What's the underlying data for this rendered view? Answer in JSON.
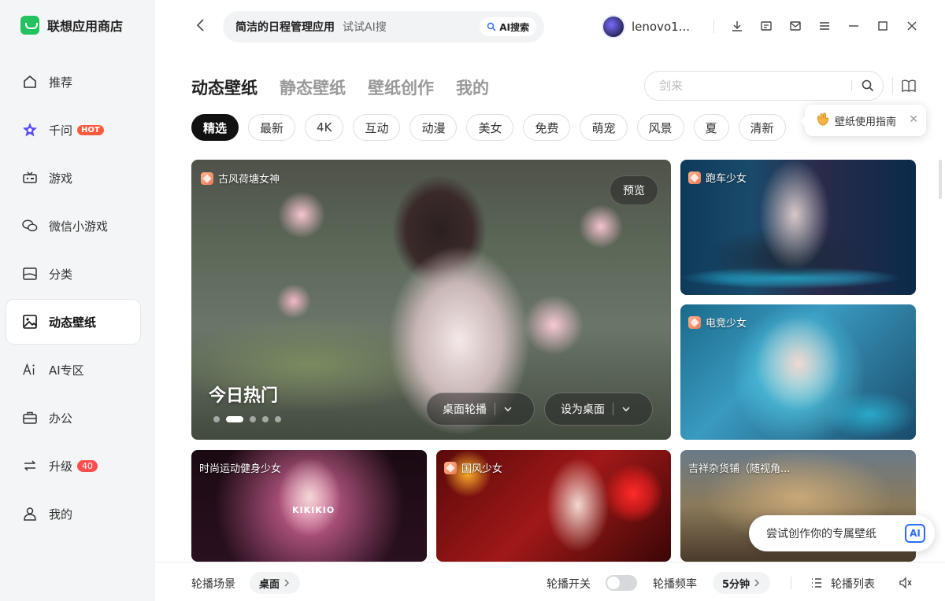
{
  "brand": {
    "name": "联想应用商店"
  },
  "sidebar": {
    "items": [
      {
        "label": "推荐"
      },
      {
        "label": "千问",
        "badge": "HOT"
      },
      {
        "label": "游戏"
      },
      {
        "label": "微信小游戏"
      },
      {
        "label": "分类"
      },
      {
        "label": "动态壁纸",
        "active": true
      },
      {
        "label": "AI专区"
      },
      {
        "label": "办公"
      },
      {
        "label": "升级",
        "badge": "40"
      },
      {
        "label": "我的"
      }
    ]
  },
  "topbar": {
    "search_query": "简洁的日程管理应用",
    "search_hint": "试试AI搜",
    "ai_search_label": "AI搜索",
    "username": "lenovo1..."
  },
  "main_tabs": [
    {
      "label": "动态壁纸",
      "active": true
    },
    {
      "label": "静态壁纸"
    },
    {
      "label": "壁纸创作"
    },
    {
      "label": "我的"
    }
  ],
  "wallpaper_search": {
    "placeholder": "剑来"
  },
  "tags": [
    "精选",
    "最新",
    "4K",
    "互动",
    "动漫",
    "美女",
    "免费",
    "萌宠",
    "风景",
    "夏",
    "清新"
  ],
  "guide_tip": {
    "label": "壁纸使用指南"
  },
  "hero": {
    "label": "古风荷塘女神",
    "preview": "预览",
    "title": "今日热门",
    "carousel_btn": "桌面轮播",
    "set_desktop_btn": "设为桌面"
  },
  "cards": {
    "racer": "跑车少女",
    "esports": "电竞少女",
    "fitness": "时尚运动健身少女",
    "fitness_shirt": "KIKIKIO",
    "guofeng": "国风少女",
    "grocery": "吉祥杂货铺（随视角..."
  },
  "ai_create": {
    "label": "尝试创作你的专属壁纸",
    "badge": "AI"
  },
  "bottombar": {
    "scene_label": "轮播场景",
    "scene_value": "桌面",
    "switch_label": "轮播开关",
    "switch_on": false,
    "freq_label": "轮播频率",
    "freq_value": "5分钟",
    "list_label": "轮播列表"
  },
  "colors": {
    "accent": "#22c35e",
    "hot": "#ff5a3c",
    "ai_blue": "#2a6cf6"
  }
}
